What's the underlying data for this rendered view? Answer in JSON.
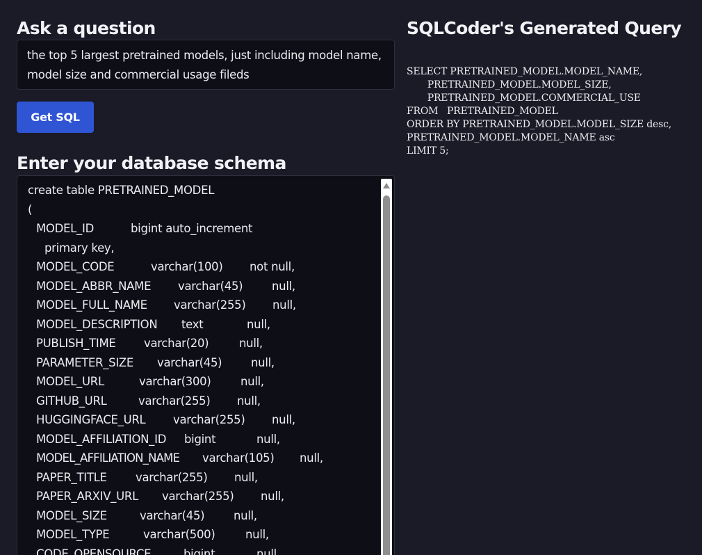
{
  "ask": {
    "title": "Ask a question",
    "question": "the top 5 largest pretrained models, just including model name, model size and commercial usage fileds"
  },
  "button": {
    "label": "Get SQL"
  },
  "schema": {
    "title": "Enter your database schema",
    "lines": [
      {
        "cols": [
          "create table PRETRAINED_MODEL"
        ]
      },
      {
        "cols": [
          "("
        ]
      },
      {
        "cols": [
          "MODEL_ID",
          "bigint auto_increment"
        ]
      },
      {
        "cols": [
          "primary key,"
        ]
      },
      {
        "cols": [
          "MODEL_CODE",
          "varchar(100)",
          "not null,"
        ]
      },
      {
        "cols": [
          "MODEL_ABBR_NAME",
          "varchar(45)",
          "null,"
        ]
      },
      {
        "cols": [
          "MODEL_FULL_NAME",
          "varchar(255)",
          "null,"
        ]
      },
      {
        "cols": [
          "MODEL_DESCRIPTION",
          "text",
          "null,"
        ]
      },
      {
        "cols": [
          "PUBLISH_TIME",
          "varchar(20)",
          "null,"
        ]
      },
      {
        "cols": [
          "PARAMETER_SIZE",
          "varchar(45)",
          "null,"
        ]
      },
      {
        "cols": [
          "MODEL_URL",
          "varchar(300)",
          "null,"
        ]
      },
      {
        "cols": [
          "GITHUB_URL",
          "varchar(255)",
          "null,"
        ]
      },
      {
        "cols": [
          "HUGGINGFACE_URL",
          "varchar(255)",
          "null,"
        ]
      },
      {
        "cols": [
          "MODEL_AFFILIATION_ID",
          "bigint",
          "null,"
        ]
      },
      {
        "cols": [
          "MODEL_AFFILIATION_NAME",
          "varchar(105)",
          "null,"
        ]
      },
      {
        "cols": [
          "PAPER_TITLE",
          "varchar(255)",
          "null,"
        ]
      },
      {
        "cols": [
          "PAPER_ARXIV_URL",
          "varchar(255)",
          "null,"
        ]
      },
      {
        "cols": [
          "MODEL_SIZE",
          "varchar(45)",
          "null,"
        ]
      },
      {
        "cols": [
          "MODEL_TYPE",
          "varchar(500)",
          "null,"
        ]
      },
      {
        "cols": [
          "CODE_OPENSOURCE",
          "bigint",
          "null,"
        ]
      }
    ]
  },
  "query": {
    "title": "SQLCoder's Generated Query",
    "lines": [
      "SELECT PRETRAINED_MODEL.MODEL_NAME,",
      "       PRETRAINED_MODEL.MODEL_SIZE,",
      "       PRETRAINED_MODEL.COMMERCIAL_USE",
      "FROM   PRETRAINED_MODEL",
      "ORDER BY PRETRAINED_MODEL.MODEL_SIZE desc,",
      "PRETRAINED_MODEL.MODEL_NAME asc",
      "LIMIT 5;"
    ]
  },
  "colors": {
    "background": "#1a1b27",
    "input_background": "#0e0e17",
    "button": "#2f55d4"
  }
}
